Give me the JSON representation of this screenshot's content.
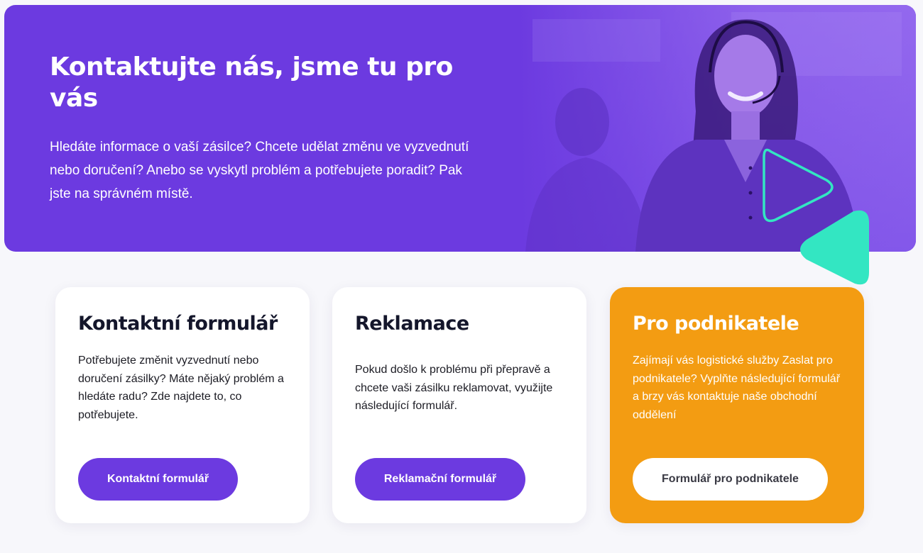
{
  "hero": {
    "title": "Kontaktujte nás, jsme tu pro vás",
    "text": "Hledáte informace o vaší zásilce? Chcete udělat změnu ve vyzvednutí nebo doručení? Anebo se vyskytl problém a potřebujete poradit? Pak jste na správném místě."
  },
  "cards": [
    {
      "title": "Kontaktní formulář",
      "text": "Potřebujete změnit vyzvednutí nebo doručení zásilky? Máte nějaký problém a hledáte radu? Zde najdete to, co potřebujete.",
      "button": "Kontaktní formulář"
    },
    {
      "title": "Reklamace",
      "text": "Pokud došlo k problému při přepravě a chcete vaši zásilku reklamovat, využijte následující formulář.",
      "button": "Reklamační formulář"
    },
    {
      "title": "Pro podnikatele",
      "text": "Zajímají vás logistické služby Zaslat pro podnikatele? Vyplňte následující formulář a brzy vás kontaktuje naše obchodní oddělení",
      "button": "Formulář pro podnikatele"
    }
  ],
  "colors": {
    "brand_purple": "#6c3ae0",
    "accent_orange": "#f39c12",
    "accent_mint": "#33e6c2"
  },
  "icons": {
    "play_outline": "play-triangle-outline-icon",
    "play_filled": "play-triangle-filled-icon"
  }
}
